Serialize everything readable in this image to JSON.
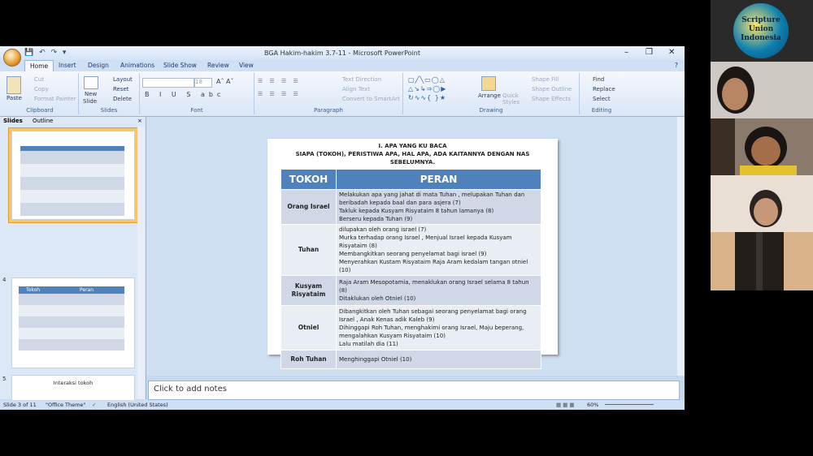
{
  "window": {
    "title": "BGA Hakim-hakim 3.7-11 - Microsoft PowerPoint"
  },
  "tabs": [
    "Home",
    "Insert",
    "Design",
    "Animations",
    "Slide Show",
    "Review",
    "View"
  ],
  "ribbon": {
    "clipboard": {
      "paste": "Paste",
      "cut": "Cut",
      "copy": "Copy",
      "format_painter": "Format Painter",
      "label": "Clipboard"
    },
    "slides": {
      "new_slide": "New",
      "new_slide_2": "Slide",
      "layout": "Layout",
      "reset": "Reset",
      "delete": "Delete",
      "label": "Slides"
    },
    "font": {
      "label": "Font",
      "size": "18"
    },
    "paragraph": {
      "text_direction": "Text Direction",
      "align_text": "Align Text",
      "smartart": "Convert to SmartArt",
      "label": "Paragraph"
    },
    "drawing": {
      "arrange": "Arrange",
      "quick_styles": "Quick",
      "quick_styles_2": "Styles",
      "shape_fill": "Shape Fill",
      "shape_outline": "Shape Outline",
      "shape_effects": "Shape Effects",
      "label": "Drawing"
    },
    "editing": {
      "find": "Find",
      "replace": "Replace",
      "select": "Select",
      "label": "Editing"
    }
  },
  "left_pane": {
    "tabs": [
      "Slides",
      "Outline"
    ],
    "thumb3_num": "",
    "thumb4_num": "4",
    "thumb4_header": [
      "Tokoh",
      "Peran"
    ],
    "thumb5_num": "5",
    "thumb5_title": "Interaksi tokoh"
  },
  "slide": {
    "title_line1": "I. APA YANG KU BACA",
    "title_line2": "SIAPA (TOKOH), PERISTIWA APA, HAL APA, ADA KAITANNYA DENGAN NAS",
    "title_line3": "SEBELUMNYA.",
    "header": [
      "TOKOH",
      "PERAN"
    ],
    "rows": [
      {
        "tokoh": "Orang Israel",
        "peran": [
          "Melakukan apa yang jahat di mata Tuhan , melupakan Tuhan dan beribadah kepada baal dan para asjera (7)",
          "Takluk kepada Kusyam Risyataim 8 tahun lamanya (8)",
          "Berseru kepada Tuhan (9)"
        ]
      },
      {
        "tokoh": "Tuhan",
        "peran": [
          "dilupakan oleh orang israel  (7)",
          "Murka terhadap orang Israel , Menjual Israel kepada Kusyam Risyataim (8)",
          "Membangkitkan seorang penyelamat bagi israel (9)",
          "Menyerahkan Kustam Risyataim Raja Aram kedalam tangan otniel (10)"
        ]
      },
      {
        "tokoh": "Kusyam Risyataim",
        "peran": [
          "Raja Aram Mesopotamia, menaklukan orang Israel selama 8 tahun (8)",
          "Ditaklukan oleh Otniel (10)"
        ]
      },
      {
        "tokoh": "Otniel",
        "peran": [
          "Dibangkitkan oleh Tuhan sebagai seorang penyelamat bagi orang Israel , Anak Kenas adik Kaleb (9)",
          "Dihinggapi Roh Tuhan, menghakimi  orang Israel, Maju beperang, mengalahkan Kusyam Risyataim  (10)",
          "Lalu matilah dia (11)"
        ]
      },
      {
        "tokoh": "Roh Tuhan",
        "peran": [
          "Menghinggapi Otniel (10)"
        ]
      }
    ]
  },
  "notes": {
    "placeholder": "Click to add notes"
  },
  "status": {
    "slide": "Slide 3 of 11",
    "theme": "\"Office Theme\"",
    "language": "English (United States)",
    "zoom": "60%"
  },
  "logo": {
    "line1": "Scripture",
    "line2": "Union",
    "line3": "Indonesia"
  },
  "colors": {
    "table_header": "#4f81bd",
    "row_odd": "#d0d8e8",
    "row_even": "#e9edf4"
  }
}
